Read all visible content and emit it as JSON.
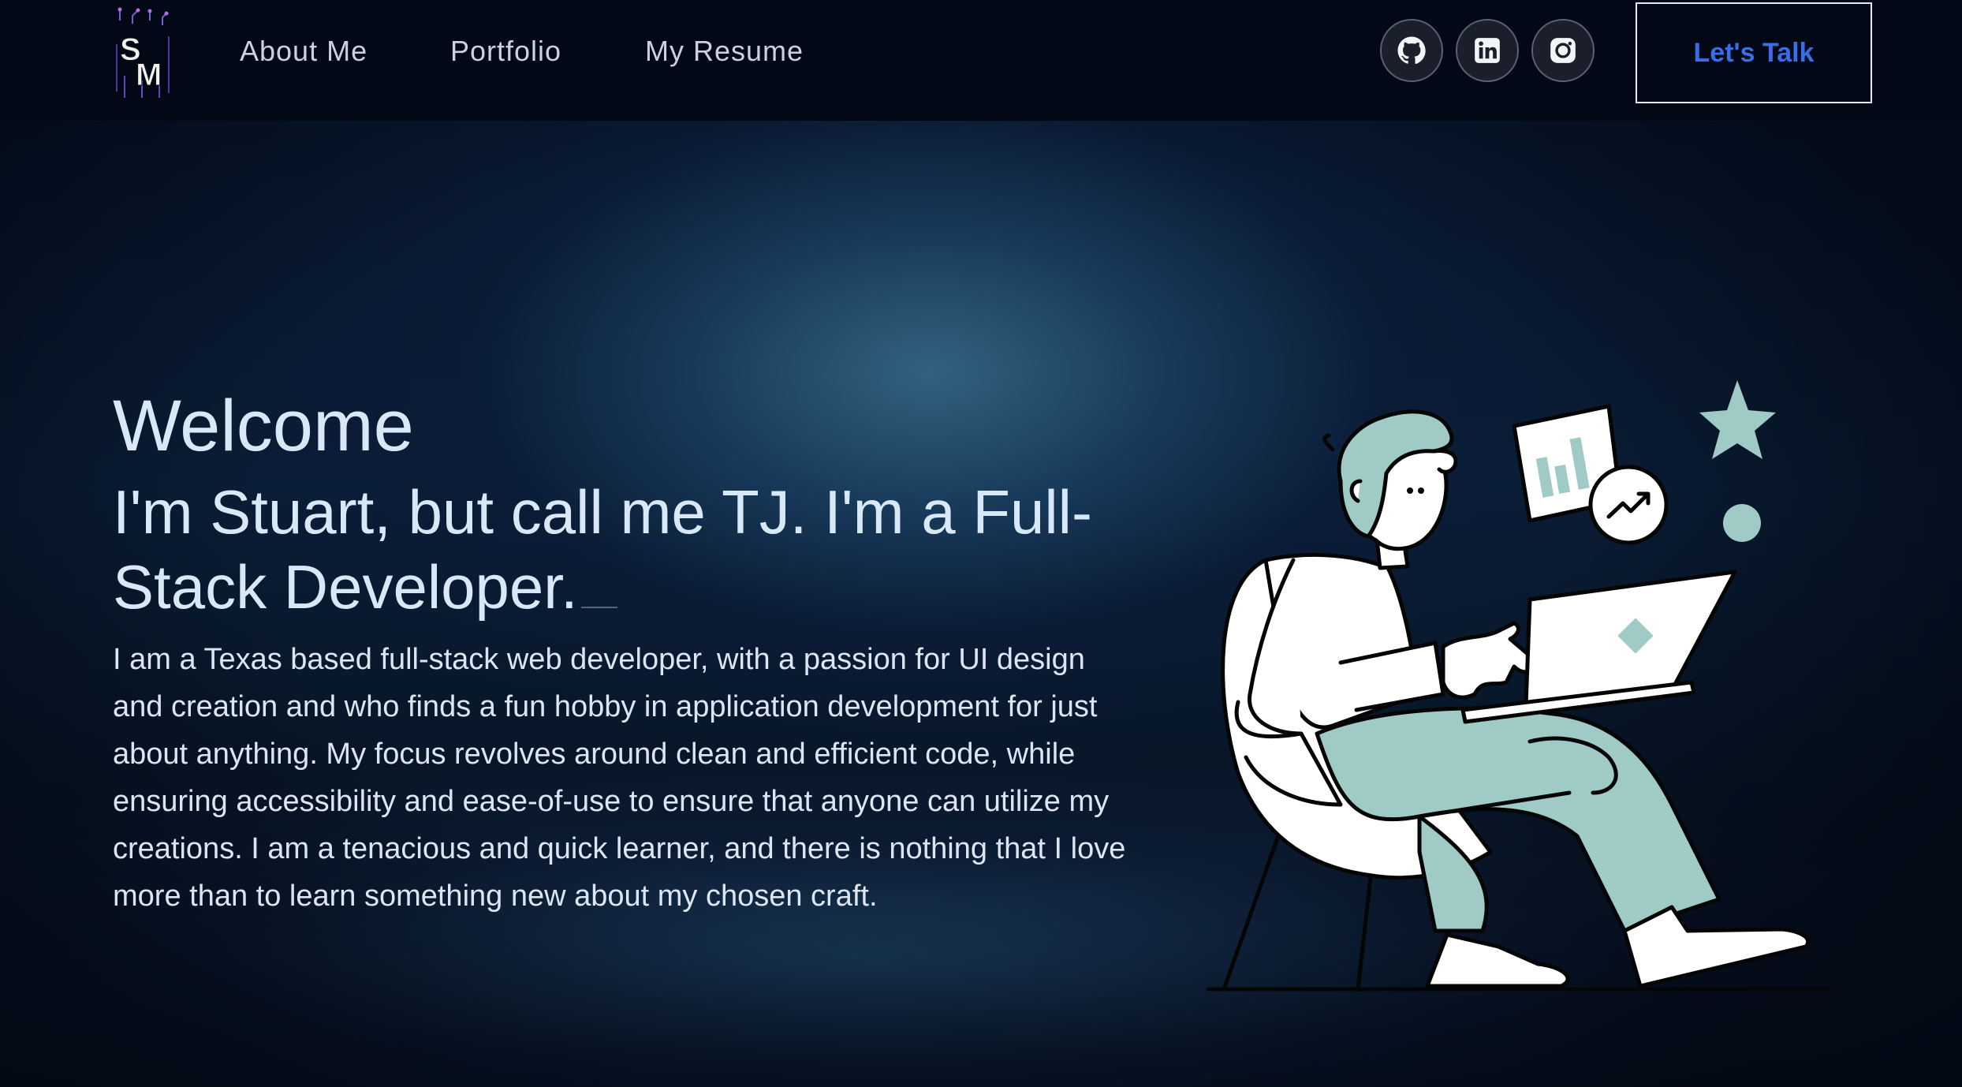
{
  "nav": {
    "logo_alt": "SM",
    "links": [
      "About Me",
      "Portfolio",
      "My Resume"
    ],
    "social": [
      {
        "name": "GitHub",
        "icon": "github-icon"
      },
      {
        "name": "LinkedIn",
        "icon": "linkedin-icon"
      },
      {
        "name": "Instagram",
        "icon": "instagram-icon"
      }
    ],
    "cta_label": "Let's Talk"
  },
  "hero": {
    "welcome": "Welcome",
    "headline": "I'm Stuart, but call me TJ. I'm a Full-Stack Developer.",
    "bio": "I am a Texas based full-stack web developer, with a passion for UI design and creation and who finds a fun hobby in application development for just about anything. My focus revolves around clean and efficient code, while ensuring accessibility and ease-of-use to ensure that anyone can utilize my creations. I am a tenacious and quick learner, and there is nothing that I love more than to learn something new about my chosen craft."
  },
  "colors": {
    "nav_background": "#030816",
    "accent_blue": "#3a6ee8",
    "illustration_teal": "#9fcac6",
    "text_light": "#d8e8f6"
  }
}
